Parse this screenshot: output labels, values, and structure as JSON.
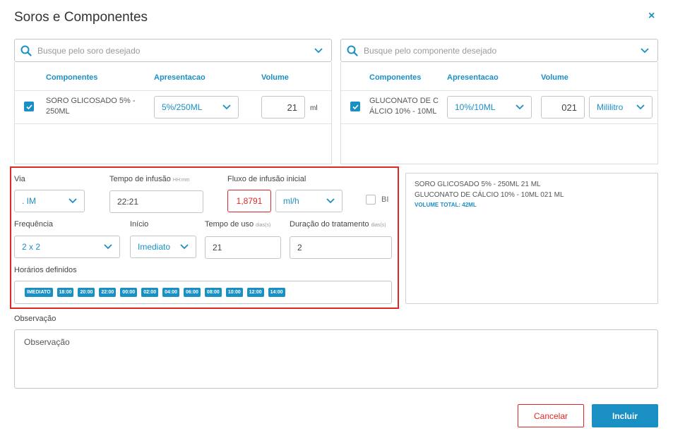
{
  "header": {
    "title": "Soros e Componentes",
    "close_label": "×"
  },
  "soro_panel": {
    "search_placeholder": "Busque pelo soro desejado",
    "columns": [
      "Componentes",
      "Apresentacao",
      "Volume"
    ],
    "row": {
      "name": "SORO GLICOSADO 5% - 250ML",
      "name_l1": "SORO GLICOSADO 5% -",
      "name_l2": "250ML",
      "apresentacao": "5%/250ML",
      "volume": "21",
      "unit": "ml",
      "checked": true
    }
  },
  "componente_panel": {
    "search_placeholder": "Busque pelo componente desejado",
    "columns": [
      "Componentes",
      "Apresentacao",
      "Volume"
    ],
    "row": {
      "name_l1": "GLUCONATO DE C",
      "name_l2": "ÁLCIO 10% - 10ML",
      "apresentacao": "10%/10ML",
      "volume": "021",
      "unit": "Mililitro",
      "checked": true
    }
  },
  "form": {
    "via": {
      "label": "Via",
      "value": ". IM"
    },
    "tempo_infusao": {
      "label": "Tempo de infusão",
      "hint": "HH:mm",
      "value": "22:21"
    },
    "fluxo": {
      "label": "Fluxo de infusão inicial",
      "value": "1,8791",
      "unit": "ml/h"
    },
    "bi": {
      "label": "BI",
      "checked": false
    },
    "frequencia": {
      "label": "Frequência",
      "value": "2 x 2"
    },
    "inicio": {
      "label": "Início",
      "value": "Imediato"
    },
    "tempo_uso": {
      "label": "Tempo de uso",
      "hint": "dias(s)",
      "value": "21"
    },
    "duracao": {
      "label": "Duração do tratamento",
      "hint": "dias(s)",
      "value": "2"
    },
    "horarios": {
      "label": "Horários definidos",
      "items": [
        "IMEDIATO",
        "18:00",
        "20:00",
        "22:00",
        "00:00",
        "02:00",
        "04:00",
        "06:00",
        "08:00",
        "10:00",
        "12:00",
        "14:00"
      ]
    }
  },
  "summary": {
    "line1": "SORO GLICOSADO 5% - 250ML 21 ML",
    "line2": "GLUCONATO DE CÁLCIO 10% - 10ML 021 ML",
    "total": "VOLUME TOTAL: 42ML"
  },
  "observacao": {
    "label": "Observação",
    "placeholder": "Observação"
  },
  "actions": {
    "cancel": "Cancelar",
    "submit": "Incluir"
  },
  "colors": {
    "accent": "#1a8fc4",
    "highlight_border": "#e02727",
    "error_text": "#e02727",
    "primary_button": "#1a8fc4"
  }
}
